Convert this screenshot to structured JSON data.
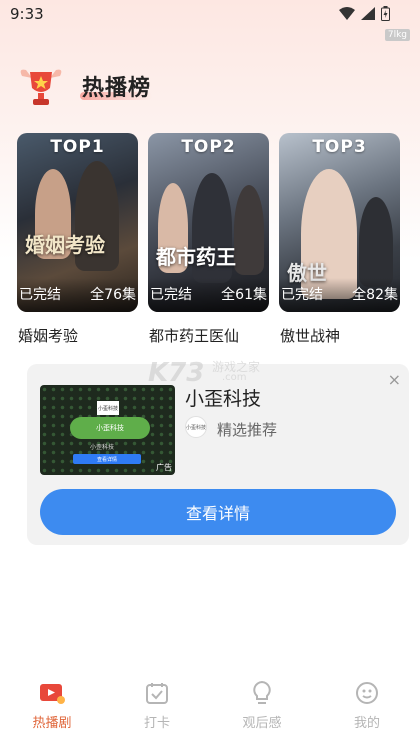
{
  "status_bar": {
    "time": "9:33",
    "tag": "7lkg"
  },
  "header": {
    "title": "热播榜"
  },
  "ranking": [
    {
      "rank": "TOP1",
      "title": "婚姻考验",
      "poster_text": "婚姻考验",
      "status": "已完结",
      "episodes": "全76集"
    },
    {
      "rank": "TOP2",
      "title": "都市药王医仙",
      "poster_text": "都市药王",
      "status": "已完结",
      "episodes": "全61集"
    },
    {
      "rank": "TOP3",
      "title": "傲世战神",
      "poster_text": "傲世",
      "status": "已完结",
      "episodes": "全82集"
    }
  ],
  "watermark": {
    "big": "K73",
    "line1": "游戏之家",
    "line2": ".com"
  },
  "ad": {
    "name": "小歪科技",
    "subtitle": "精选推荐",
    "button": "查看详情",
    "close": "×",
    "thumb_tag": "广告",
    "thumb_logo": "小歪科技",
    "thumb_panel": "小歪科技",
    "thumb_sub": "小歪科技",
    "thumb_button": "查看详情",
    "mini_logo": "小歪科技"
  },
  "tabs": [
    {
      "label": "热播剧",
      "icon": "tv-play-icon",
      "active": true
    },
    {
      "label": "打卡",
      "icon": "calendar-check-icon",
      "active": false
    },
    {
      "label": "观后感",
      "icon": "lightbulb-icon",
      "active": false
    },
    {
      "label": "我的",
      "icon": "smiley-face-icon",
      "active": false
    }
  ],
  "colors": {
    "accent": "#e0663a",
    "button_blue": "#3d8bf0",
    "inactive": "#b5b5b5"
  }
}
